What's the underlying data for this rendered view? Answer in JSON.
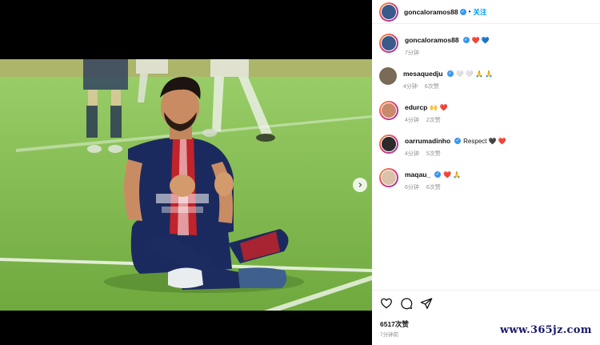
{
  "post": {
    "author": "goncaloramos88",
    "follow_label": "关注",
    "likes": "6517次赞",
    "time": "7分钟前",
    "caption": {
      "author": "goncaloramos88",
      "emoji": "❤️ 💙",
      "time": "7分钟"
    }
  },
  "comments": [
    {
      "user": "mesaquedju",
      "verified": true,
      "text": "🤍 🤍 🙏 🙏",
      "time": "4分钟",
      "likes": "6次赞"
    },
    {
      "user": "edurcp",
      "verified": false,
      "text": "🙌 ❤️",
      "time": "4分钟",
      "likes": "2次赞"
    },
    {
      "user": "oarrumadinho",
      "verified": true,
      "text": "Respect 🖤 ❤️",
      "time": "4分钟",
      "likes": "5次赞"
    },
    {
      "user": "maqau_",
      "verified": true,
      "text": "❤️ 🙏",
      "time": "6分钟",
      "likes": "6次赞"
    }
  ],
  "icons": [
    "heart-icon",
    "comment-icon",
    "share-icon",
    "verified-icon",
    "chevron-right-icon"
  ],
  "colors": {
    "accent": "#0095f6",
    "verified": "#3897f0",
    "jersey": "#1b2a5e",
    "pitch": "#7fb84a"
  },
  "watermark": "www.365jz.com"
}
